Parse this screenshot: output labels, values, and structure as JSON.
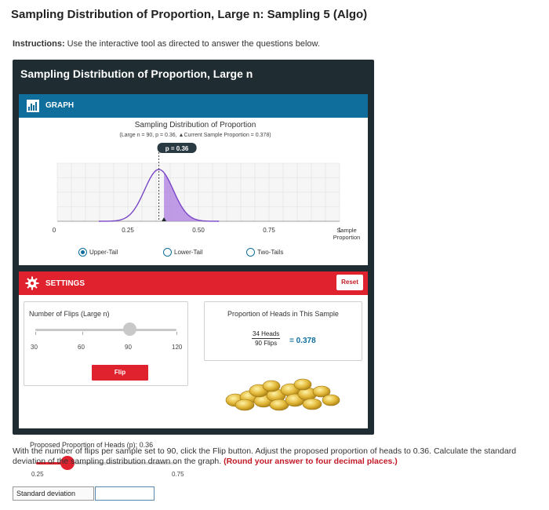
{
  "page": {
    "title": "Sampling Distribution of Proportion, Large n: Sampling 5 (Algo)",
    "instructions_label": "Instructions:",
    "instructions_text": " Use the interactive tool as directed to answer the questions below."
  },
  "tool": {
    "title": "Sampling Distribution of Proportion, Large n",
    "graph_tab": "GRAPH",
    "settings_tab": "SETTINGS",
    "reset_label": "Reset"
  },
  "chart_data": {
    "type": "area",
    "title": "Sampling Distribution of Proportion",
    "subtitle": "(Large n = 90, p = 0.36, ▲Current Sample Proportion = 0.378)",
    "mean_badge": "p = 0.36",
    "mean": 0.36,
    "n": 90,
    "current_sample_proportion": 0.378,
    "xlim": [
      0,
      1
    ],
    "x_ticks": [
      "0",
      "0.25",
      "0.50",
      "0.75",
      "1"
    ],
    "xlabel": "Sample Proportion",
    "grid": true,
    "fill_color": "#b48be0",
    "curve_color": "#7a46c8",
    "legend": [
      "Upper-Tail",
      "Lower-Tail",
      "Two-Tails"
    ],
    "selected_tail": "Upper-Tail"
  },
  "settings": {
    "flips_label": "Number of Flips (Large n)",
    "flips_ticks": [
      "30",
      "60",
      "90",
      "120"
    ],
    "flips_min": 30,
    "flips_max": 120,
    "flips_value": 90,
    "flip_button": "Flip",
    "proportion_label": "Proposed Proportion of Heads (p): 0.36",
    "proportion_min_label": "0.25",
    "proportion_max_label": "0.75",
    "proportion_min": 0.25,
    "proportion_max": 0.75,
    "proportion_value": 0.36,
    "heads_title": "Proportion of Heads in This Sample",
    "heads_numerator": "34 Heads",
    "heads_denominator": "90 Flips",
    "heads_result": "= 0.378",
    "slider_color": "#e0222f"
  },
  "question": {
    "text": "With the number of flips per sample set to 90, click the Flip button. Adjust the proposed proportion of heads to 0.36. Calculate the standard deviation of the sampling distribution drawn on the graph.",
    "hint": "(Round your answer to four decimal places.)",
    "answer_label": "Standard deviation",
    "answer_value": ""
  }
}
